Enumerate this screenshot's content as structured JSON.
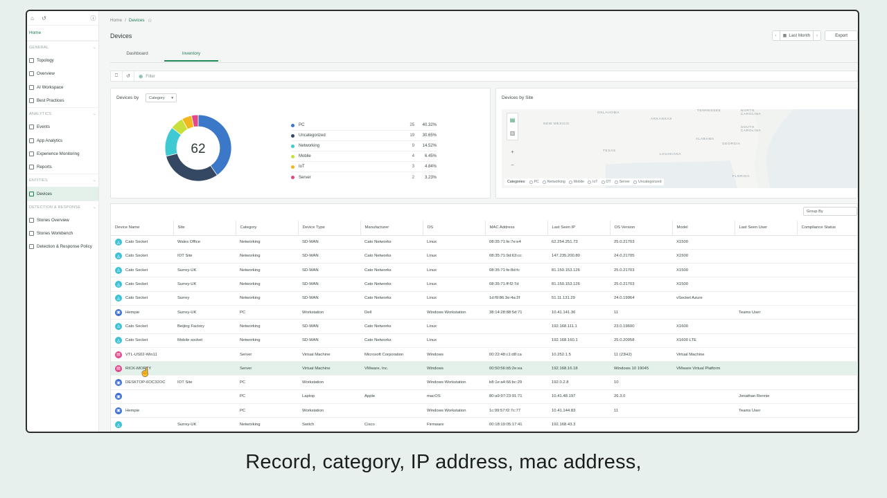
{
  "sidebar": {
    "home": "Home",
    "sections": [
      {
        "title": "GENERAL",
        "items": [
          "Topology",
          "Overview",
          "AI Workspace",
          "Best Practices"
        ]
      },
      {
        "title": "ANALYTICS",
        "items": [
          "Events",
          "App Analytics",
          "Experience Monitoring",
          "Reports"
        ]
      },
      {
        "title": "ENTITIES",
        "items": [
          "Devices"
        ]
      },
      {
        "title": "DETECTION & RESPONSE",
        "items": [
          "Stories Overview",
          "Stories Workbench",
          "Detection & Response Policy"
        ]
      }
    ],
    "active_item": "Devices"
  },
  "breadcrumb": {
    "home": "Home",
    "sep": "/",
    "current": "Devices"
  },
  "page": {
    "title": "Devices"
  },
  "date_range": {
    "label": "Last Month"
  },
  "export_label": "Export",
  "tabs": [
    "Dashboard",
    "Inventory"
  ],
  "active_tab": "Inventory",
  "filter": {
    "placeholder": "Filter"
  },
  "donut_card": {
    "title": "Devices by",
    "selector": "Category",
    "total": "62",
    "legend": [
      {
        "name": "PC",
        "count": "25",
        "pct": "40.32%",
        "color": "#3b78c8"
      },
      {
        "name": "Uncategorized",
        "count": "19",
        "pct": "30.65%",
        "color": "#344863"
      },
      {
        "name": "Networking",
        "count": "9",
        "pct": "14.52%",
        "color": "#3ec9d3"
      },
      {
        "name": "Mobile",
        "count": "4",
        "pct": "6.45%",
        "color": "#c9df3b"
      },
      {
        "name": "IoT",
        "count": "3",
        "pct": "4.84%",
        "color": "#f2b71f"
      },
      {
        "name": "Server",
        "count": "2",
        "pct": "3.23%",
        "color": "#e0488a"
      }
    ]
  },
  "chart_data": {
    "type": "pie",
    "categories": [
      "PC",
      "Uncategorized",
      "Networking",
      "Mobile",
      "IoT",
      "Server"
    ],
    "values": [
      25,
      19,
      9,
      4,
      3,
      2
    ]
  },
  "map_card": {
    "title": "Devices by Site",
    "labels": [
      "OKLAHOMA",
      "ARKANSAS",
      "TENNESSEE",
      "NORTH CAROLINA",
      "NEW MEXICO",
      "SOUTH CAROLINA",
      "GEORGIA",
      "ALABAMA",
      "TEXAS",
      "LOUISIANA",
      "FLORIDA"
    ],
    "legend_title": "Categories:",
    "legend_items": [
      "PC",
      "Networking",
      "Mobile",
      "IoT",
      "OT",
      "Server",
      "Uncategorized"
    ]
  },
  "table": {
    "group_by": "Group By",
    "columns": [
      "Device Name",
      "Site",
      "Category",
      "Device Type",
      "Manufacturer",
      "OS",
      "MAC Address",
      "Last Seen IP",
      "OS Version",
      "Model",
      "Last Seen User",
      "Compliance Status"
    ],
    "rows": [
      {
        "icon": "net",
        "cells": [
          "Cato Socket",
          "Wales Office",
          "Networking",
          "SD-WAN",
          "Cato Networks",
          "Linux",
          "08:35:71:fe:7e:e4",
          "62.254.251.73",
          "25.0.21703",
          "X1500",
          "",
          ""
        ]
      },
      {
        "icon": "net",
        "cells": [
          "Cato Socket",
          "IOT Site",
          "Networking",
          "SD-WAN",
          "Cato Networks",
          "Linux",
          "08:35:71:9d:63:cc",
          "147.235.200.80",
          "24.0.21705",
          "X1500",
          "",
          ""
        ]
      },
      {
        "icon": "net",
        "cells": [
          "Cato Socket",
          "Surrey-UK",
          "Networking",
          "SD-WAN",
          "Cato Networks",
          "Linux",
          "08:35:71:fe:8d:fc",
          "81.150.153.126",
          "25.0.21703",
          "X1500",
          "",
          ""
        ]
      },
      {
        "icon": "net",
        "cells": [
          "Cato Socket",
          "Surrey-UK",
          "Networking",
          "SD-WAN",
          "Cato Networks",
          "Linux",
          "08:35:71:ff:f2:7d",
          "81.150.153.126",
          "25.0.21703",
          "X1500",
          "",
          ""
        ]
      },
      {
        "icon": "net",
        "cells": [
          "Cato Socket",
          "Surrey",
          "Networking",
          "SD-WAN",
          "Cato Networks",
          "Linux",
          "1d:f9:86:3e:4a:2f",
          "51.11.131.29",
          "24.0.19964",
          "vSocket Azure",
          "",
          ""
        ]
      },
      {
        "icon": "pc",
        "cells": [
          "Hempie",
          "Surrey-UK",
          "PC",
          "Workstation",
          "Dell",
          "Windows Workstation",
          "38:14:28:88:5d:71",
          "10.41.141.36",
          "11",
          "",
          "Teams User",
          ""
        ]
      },
      {
        "icon": "net",
        "cells": [
          "Cato Socket",
          "Beijing Factory",
          "Networking",
          "SD-WAN",
          "Cato Networks",
          "Linux",
          "",
          "192.168.111.1",
          "23.0.19600",
          "X1600",
          "",
          ""
        ]
      },
      {
        "icon": "net",
        "cells": [
          "Cato Socket",
          "Mobile socket",
          "Networking",
          "SD-WAN",
          "Cato Networks",
          "Linux",
          "",
          "192.168.160.1",
          "25.0.20958",
          "X1600 LTE",
          "",
          ""
        ]
      },
      {
        "icon": "srv",
        "cells": [
          "VTL-US02-Win11",
          "",
          "Server",
          "Virtual Machine",
          "Microsoft Corporation",
          "Windows",
          "00:22:48:c1:d8:ca",
          "10.252.1.5",
          "11 (23H2)",
          "Virtual Machine",
          "",
          ""
        ]
      },
      {
        "icon": "srv",
        "selected": true,
        "cells": [
          "RICK-MORTY",
          "",
          "Server",
          "Virtual Machine",
          "VMware, Inc.",
          "Windows",
          "00:50:56:b5:2e:ea",
          "192.168.16.18",
          "Windows 10 19045",
          "VMware Virtual Platform",
          "",
          ""
        ]
      },
      {
        "icon": "pc",
        "cells": [
          "DESKTOP-6OC32OC",
          "IOT Site",
          "PC",
          "Workstation",
          "",
          "Windows Workstation",
          "b8:1e:a4:66:bc:29",
          "192.0.2.8",
          "10",
          "",
          "",
          ""
        ]
      },
      {
        "icon": "pc",
        "cells": [
          "",
          "",
          "PC",
          "Laptop",
          "Apple",
          "macOS",
          "80:a9:97:23:91:71",
          "10.41.48.197",
          "26.3.0",
          "",
          "Jonathan Rennie",
          ""
        ]
      },
      {
        "icon": "pc",
        "cells": [
          "Hempie",
          "",
          "PC",
          "Workstation",
          "",
          "Windows Workstation",
          "1c:99:57:f2:7c:77",
          "10.41.144.83",
          "11",
          "",
          "Teams User",
          ""
        ]
      },
      {
        "icon": "net",
        "cells": [
          "",
          "Surrey-UK",
          "Networking",
          "Switch",
          "Cisco",
          "Firmware",
          "00:18:19:05:17:41",
          "192.168.43.3",
          "",
          "",
          "",
          ""
        ]
      }
    ]
  },
  "caption": "Record,  category, IP address, mac address,"
}
